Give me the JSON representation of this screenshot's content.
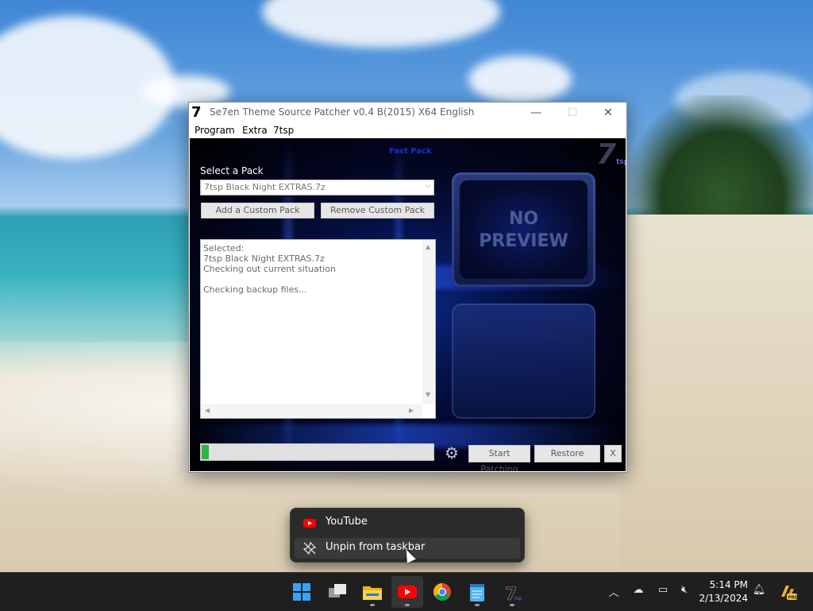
{
  "window": {
    "title_logo": "7",
    "title": "Se7en Theme Source Patcher v0.4 B(2015) X64 English",
    "minimize": "—",
    "maximize": "☐",
    "close": "✕"
  },
  "menu": [
    "Program",
    "Extra",
    "7tsp"
  ],
  "app": {
    "fast_pack_label": "Fast Pack",
    "logo_text": "7",
    "logo_sub": "tsp",
    "select_label": "Select a Pack",
    "pack_selected": "7tsp Black Night EXTRAS.7z",
    "add_button": "Add a Custom Pack",
    "remove_button": "Remove Custom Pack",
    "log_lines": [
      "Selected:",
      "7tsp Black Night EXTRAS.7z",
      "Checking out current situation",
      "",
      "Checking backup files..."
    ],
    "preview_line1": "NO",
    "preview_line2": "PREVIEW",
    "progress_fraction": 0.03,
    "start_button": "Start Patching",
    "restore_button": "Restore",
    "x_button": "X"
  },
  "context_menu": {
    "items": [
      {
        "label": "YouTube",
        "icon": "youtube-icon"
      },
      {
        "label": "Unpin from taskbar",
        "icon": "unpin-icon"
      }
    ]
  },
  "taskbar": {
    "apps": [
      "start-icon",
      "task-view-icon",
      "file-explorer-icon",
      "youtube-icon",
      "chrome-icon",
      "notepad-icon",
      "7tsp-icon"
    ],
    "clock_time": "5:14 PM",
    "clock_date": "2/13/2024"
  },
  "colors": {
    "accent_blue": "#1a2ed8",
    "progress_green": "#2db34a",
    "youtube_red": "#ff0000",
    "taskbar_bg": "#1f1f1f"
  }
}
